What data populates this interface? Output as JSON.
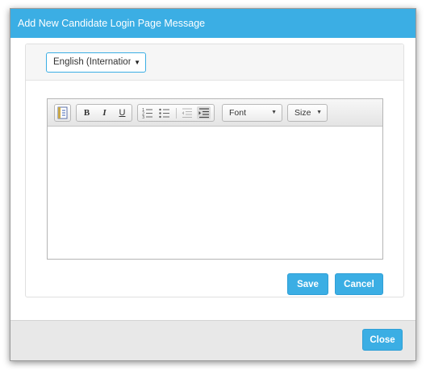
{
  "modal": {
    "title": "Add New Candidate Login Page Message"
  },
  "language_select": {
    "value": "English (International)"
  },
  "editor": {
    "toolbar": {
      "source_label": "source-icon",
      "bold_label": "B",
      "italic_label": "I",
      "underline_label": "U",
      "ordered_list_icon": "ordered-list-icon",
      "unordered_list_icon": "unordered-list-icon",
      "outdent_icon": "outdent-icon",
      "indent_icon": "indent-icon",
      "font_label": "Font",
      "size_label": "Size"
    },
    "content": ""
  },
  "actions": {
    "save_label": "Save",
    "cancel_label": "Cancel"
  },
  "footer": {
    "close_label": "Close"
  },
  "colors": {
    "accent": "#3baee4",
    "footer_bg": "#e8e8e8",
    "panel_head_bg": "#f6f6f6"
  }
}
